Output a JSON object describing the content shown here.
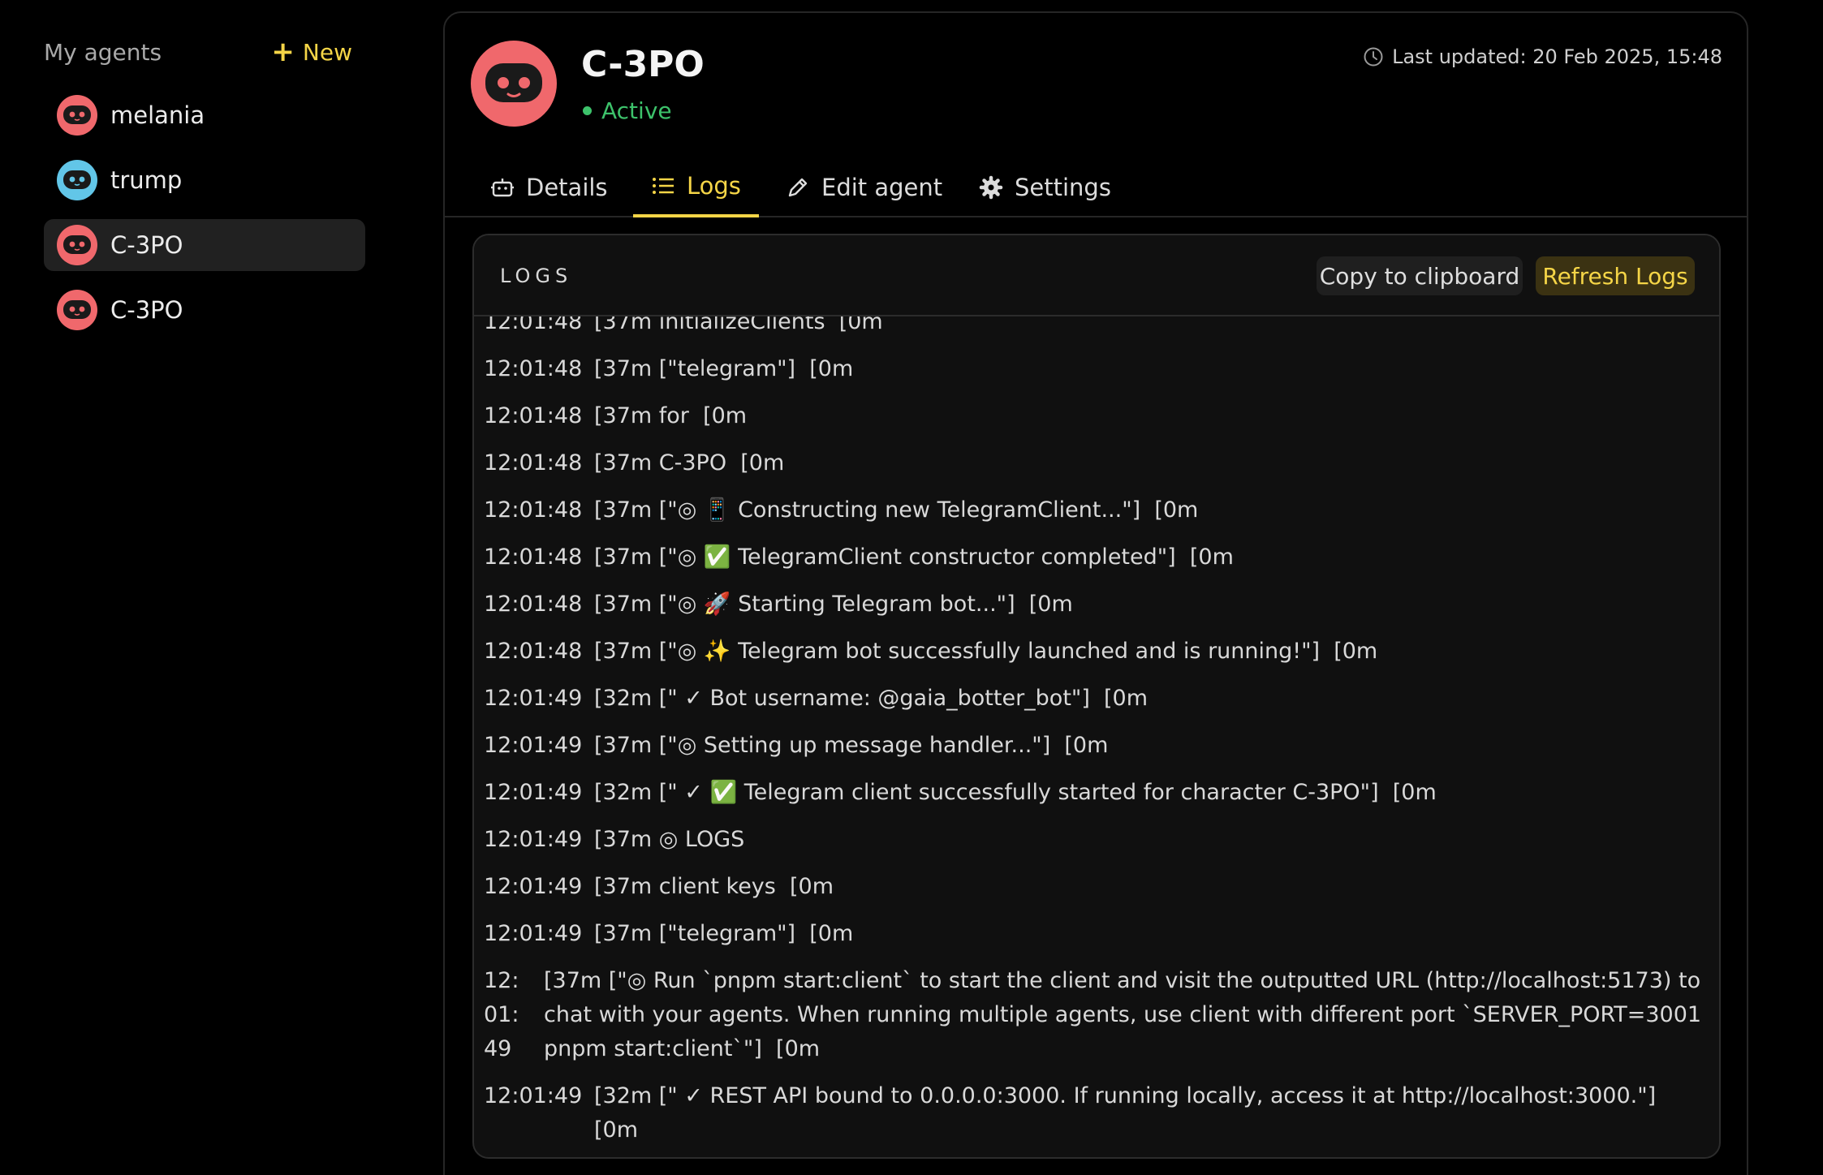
{
  "sidebar": {
    "title": "My agents",
    "new_label": "New",
    "agents": [
      {
        "name": "melania",
        "color": "#f0686c"
      },
      {
        "name": "trump",
        "color": "#62c6e8"
      },
      {
        "name": "C-3PO",
        "color": "#f0686c",
        "selected": true
      },
      {
        "name": "C-3PO",
        "color": "#f0686c"
      }
    ]
  },
  "header": {
    "name": "C-3PO",
    "status": "Active",
    "last_updated": "Last updated: 20 Feb 2025, 15:48",
    "avatar_color": "#f0686c"
  },
  "tabs": [
    {
      "label": "Details",
      "icon": "robot-icon"
    },
    {
      "label": "Logs",
      "icon": "list-icon",
      "active": true
    },
    {
      "label": "Edit agent",
      "icon": "pencil-icon"
    },
    {
      "label": "Settings",
      "icon": "gear-icon"
    }
  ],
  "logs": {
    "title": "LOGS",
    "copy_label": "Copy to clipboard",
    "refresh_label": "Refresh Logs",
    "lines": [
      {
        "ts": "12:01:48",
        "msg": "[37m initializeClients  [0m"
      },
      {
        "ts": "12:01:48",
        "msg": "[37m [\"telegram\"]  [0m"
      },
      {
        "ts": "12:01:48",
        "msg": "[37m for  [0m"
      },
      {
        "ts": "12:01:48",
        "msg": "[37m C-3PO  [0m"
      },
      {
        "ts": "12:01:48",
        "msg": "[37m [\"◎ 📱 Constructing new TelegramClient...\"]  [0m"
      },
      {
        "ts": "12:01:48",
        "msg": "[37m [\"◎ ✅ TelegramClient constructor completed\"]  [0m"
      },
      {
        "ts": "12:01:48",
        "msg": "[37m [\"◎ 🚀 Starting Telegram bot...\"]  [0m"
      },
      {
        "ts": "12:01:48",
        "msg": "[37m [\"◎ ✨ Telegram bot successfully launched and is running!\"]  [0m"
      },
      {
        "ts": "12:01:49",
        "msg": "[32m [\" ✓ Bot username: @gaia_botter_bot\"]  [0m"
      },
      {
        "ts": "12:01:49",
        "msg": "[37m [\"◎ Setting up message handler...\"]  [0m"
      },
      {
        "ts": "12:01:49",
        "msg": "[32m [\" ✓ ✅ Telegram client successfully started for character C-3PO\"]  [0m"
      },
      {
        "ts": "12:01:49",
        "msg": "[37m ◎ LOGS"
      },
      {
        "ts": "12:01:49",
        "msg": "[37m client keys  [0m"
      },
      {
        "ts": "12:01:49",
        "msg": "[37m [\"telegram\"]  [0m"
      },
      {
        "ts": "12:\n01:\n49",
        "msg": "[37m [\"◎ Run `pnpm start:client` to start the client and visit the outputted URL (http://localhost:5173) to chat with your agents. When running multiple agents, use client with different port `SERVER_PORT=3001 pnpm start:client`\"]  [0m",
        "wrap": true
      },
      {
        "ts": "12:01:49",
        "msg": "[32m [\" ✓ REST API bound to 0.0.0.0:3000. If running locally, access it at http://localhost:3000.\"]  [0m"
      }
    ]
  }
}
